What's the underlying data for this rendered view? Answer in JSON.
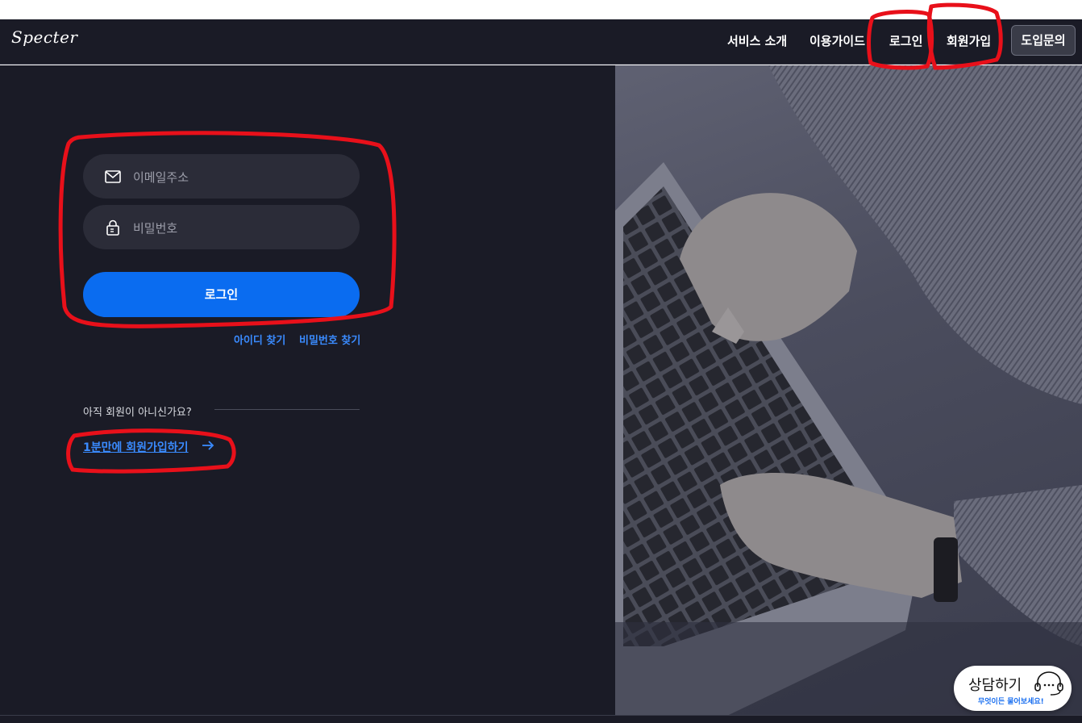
{
  "nav": {
    "logo": "Specter",
    "items": [
      "서비스 소개",
      "이용가이드",
      "로그인",
      "회원가입"
    ],
    "contact_button": "도입문의"
  },
  "login_form": {
    "email_placeholder": "이메일주소",
    "password_placeholder": "비밀번호",
    "submit_label": "로그인",
    "find_id": "아이디 찾기",
    "find_password": "비밀번호 찾기"
  },
  "signup": {
    "question": "아직 회원이 아니신가요?",
    "link": "1분만에 회원가입하기"
  },
  "chat_widget": {
    "title": "상담하기",
    "subtitle": "무엇이든 물어보세요!"
  },
  "icons": [
    "mail-icon",
    "lock-icon",
    "arrow-right-icon",
    "headset-icon"
  ],
  "colors": {
    "background": "#1a1b26",
    "field": "#2b2c38",
    "primary": "#0a6cf0",
    "link": "#3a8bff",
    "annotation": "#e8101a"
  }
}
